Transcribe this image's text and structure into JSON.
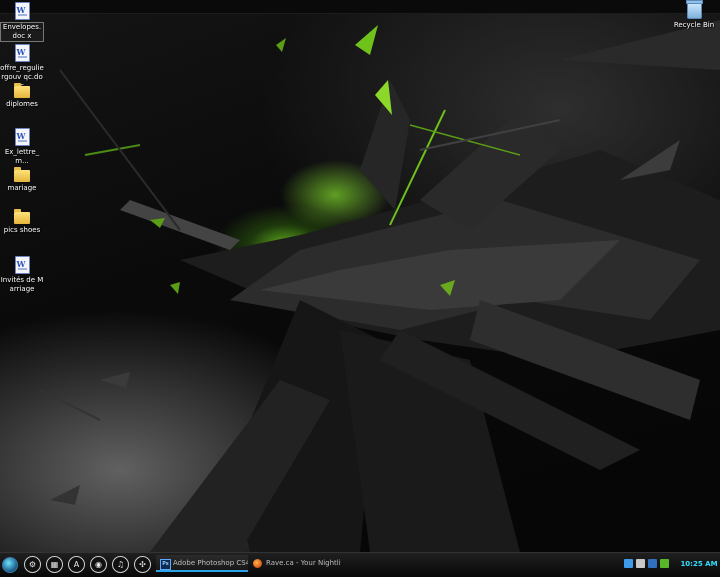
{
  "desktop": {
    "icons": [
      {
        "label": "Envelopes.doc x",
        "type": "word-doc-icon"
      },
      {
        "label": "offre_reguliergouv qc.doc",
        "type": "word-doc-icon"
      },
      {
        "label": "diplomes",
        "type": "folder-icon"
      },
      {
        "label": "Ex_lettre_m...",
        "type": "word-doc-icon"
      },
      {
        "label": "mariage",
        "type": "folder-icon"
      },
      {
        "label": "pics shoes",
        "type": "folder-icon"
      },
      {
        "label": "Invités de Marriage",
        "type": "document-icon"
      }
    ],
    "recycle_bin": {
      "label": "Recycle Bin"
    },
    "wallpaper_accent": "#8cff28"
  },
  "taskbar": {
    "quick_launch": [
      {
        "name": "settings-icon",
        "glyph": "⚙"
      },
      {
        "name": "media-icon",
        "glyph": "▦"
      },
      {
        "name": "app-launcher-icon",
        "glyph": "A"
      },
      {
        "name": "browser-icon",
        "glyph": "◉"
      },
      {
        "name": "music-icon",
        "glyph": "♫"
      },
      {
        "name": "tools-icon",
        "glyph": "✣"
      }
    ],
    "tasks": [
      {
        "label": "Adobe Photoshop CS4",
        "icon": "photoshop-icon",
        "icon_text": "Ps"
      },
      {
        "label": "Rave.ca - Your Nightlif...",
        "icon": "firefox-icon"
      }
    ],
    "clock": "10:25 AM",
    "accent": "#2aa3e6"
  }
}
